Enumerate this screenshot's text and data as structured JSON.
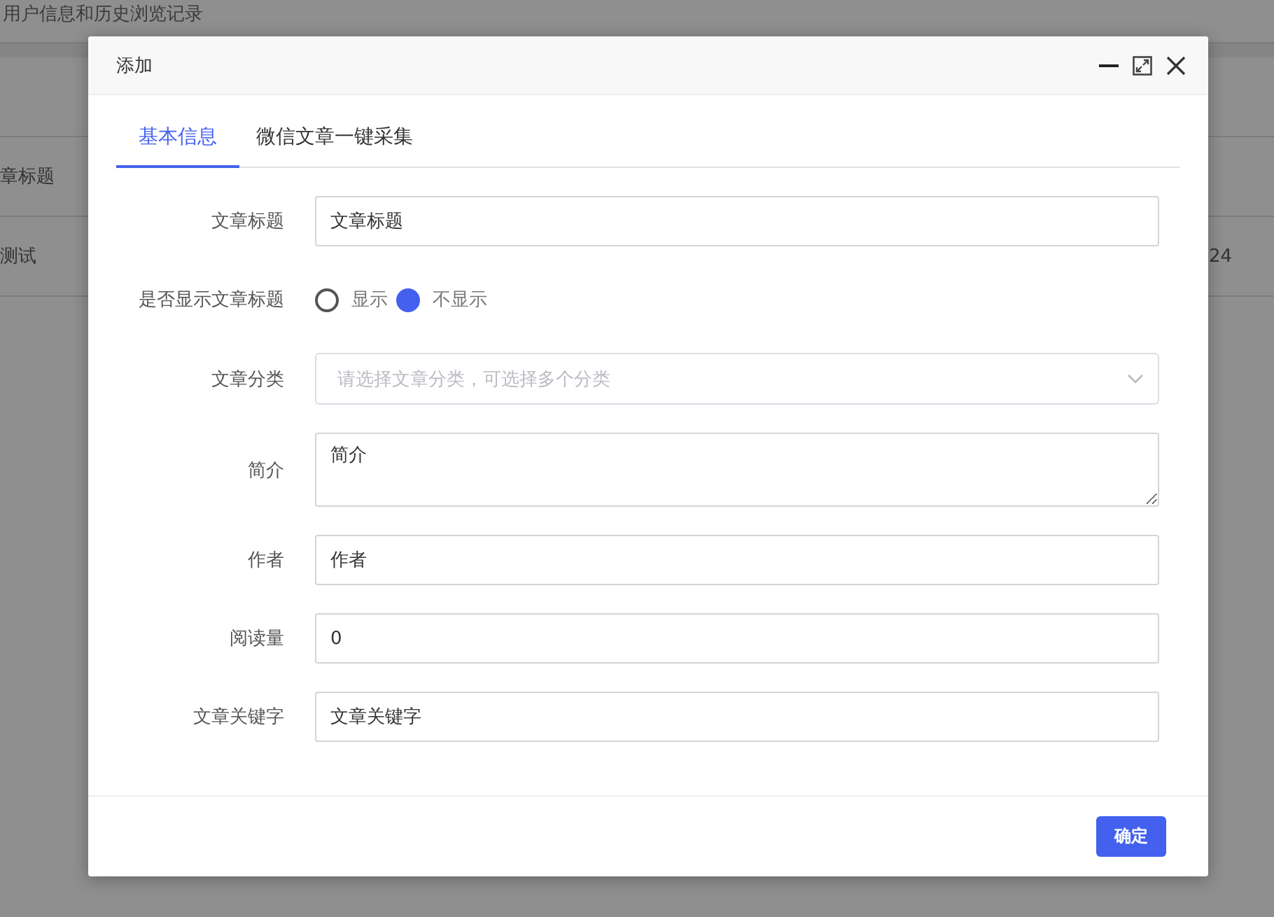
{
  "background": {
    "heading": "用户信息和历史浏览记录",
    "rows": [
      {
        "cells": [
          "",
          ""
        ]
      },
      {
        "cells": [
          "章标题",
          ""
        ]
      },
      {
        "cells": [
          "测试",
          "24"
        ]
      }
    ]
  },
  "dialog": {
    "title": "添加",
    "tabs": [
      {
        "label": "基本信息",
        "selected": true
      },
      {
        "label": "微信文章一键采集",
        "selected": false
      }
    ],
    "fields": [
      {
        "kind": "input",
        "label": "文章标题",
        "placeholder": "文章标题"
      },
      {
        "kind": "radio",
        "label": "是否显示文章标题",
        "options": [
          {
            "label": "显示",
            "selected": false
          },
          {
            "label": "不显示",
            "selected": true
          }
        ]
      },
      {
        "kind": "select",
        "label": "文章分类",
        "placeholder": "请选择文章分类，可选择多个分类"
      },
      {
        "kind": "textarea",
        "label": "简介",
        "placeholder": "简介"
      },
      {
        "kind": "input",
        "label": "作者",
        "placeholder": "作者"
      },
      {
        "kind": "input",
        "label": "阅读量",
        "value": "0"
      },
      {
        "kind": "input",
        "label": "文章关键字",
        "placeholder": "文章关键字"
      }
    ],
    "confirm_button": "确定"
  }
}
